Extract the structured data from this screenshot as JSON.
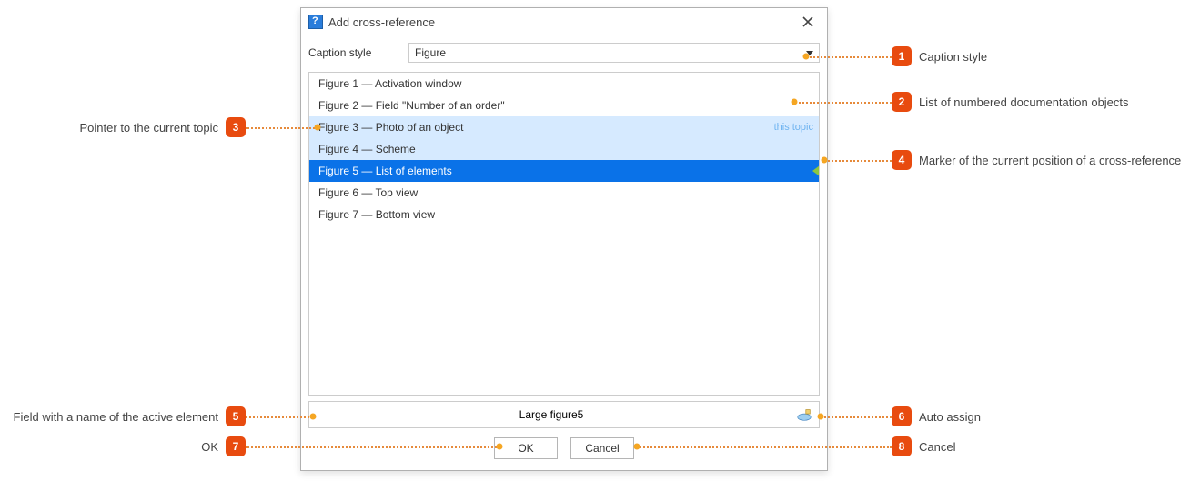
{
  "dialog": {
    "title": "Add cross-reference",
    "caption_label": "Caption style",
    "caption_value": "Figure",
    "this_topic_label": "this topic",
    "items": [
      "Figure 1 — Activation window",
      "Figure 2 — Field \"Number of an order\"",
      "Figure 3 — Photo of an object",
      "Figure 4 — Scheme",
      "Figure 5 — List of elements",
      "Figure 6 — Top view",
      "Figure 7 — Bottom view"
    ],
    "name_field_value": "Large figure5",
    "ok_label": "OK",
    "cancel_label": "Cancel"
  },
  "callouts": {
    "c1": "Caption style",
    "c2": "List of numbered documentation objects",
    "c3": "Pointer to the current topic",
    "c4": "Marker of the current position of a cross-reference",
    "c5": "Field with a name of the active element",
    "c6": "Auto assign",
    "c7": "OK",
    "c8": "Cancel"
  }
}
